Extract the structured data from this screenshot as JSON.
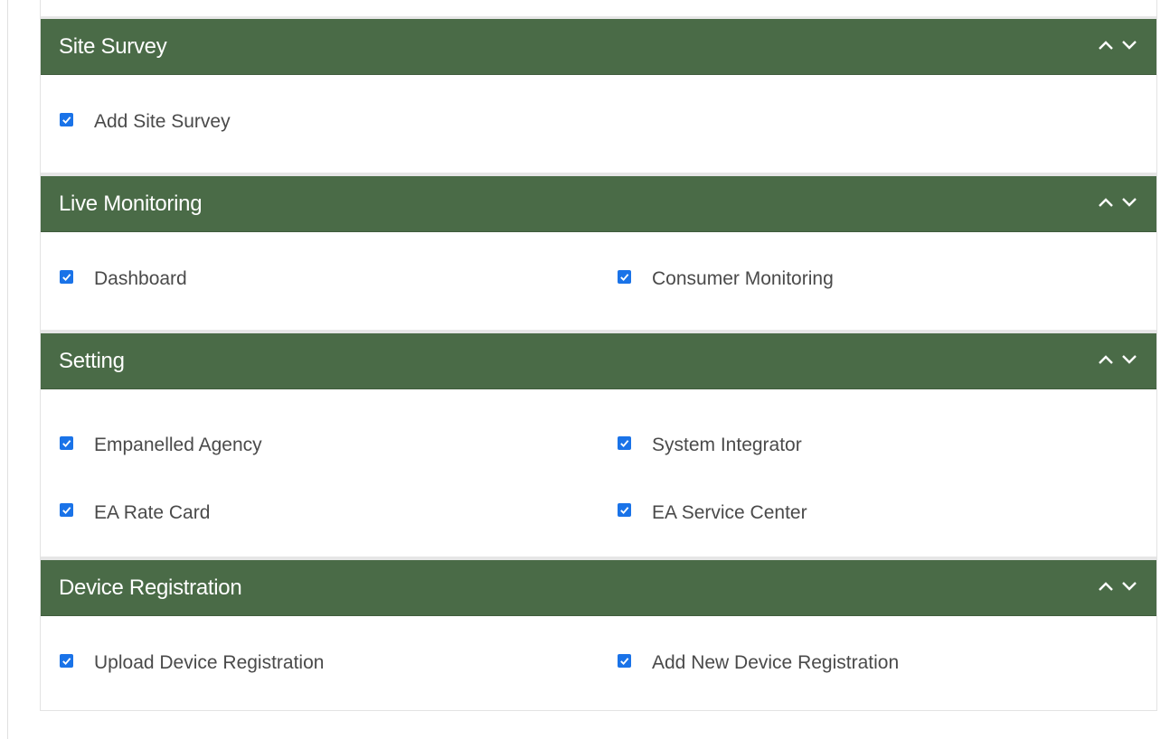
{
  "sections": [
    {
      "title": "Site Survey",
      "items": [
        {
          "label": "Add Site Survey",
          "checked": true
        }
      ]
    },
    {
      "title": "Live Monitoring",
      "items": [
        {
          "label": "Dashboard",
          "checked": true
        },
        {
          "label": "Consumer Monitoring",
          "checked": true
        }
      ]
    },
    {
      "title": "Setting",
      "items": [
        {
          "label": "Empanelled Agency",
          "checked": true
        },
        {
          "label": "System Integrator",
          "checked": true
        },
        {
          "label": "EA Rate Card",
          "checked": true
        },
        {
          "label": "EA Service Center",
          "checked": true
        }
      ]
    },
    {
      "title": "Device Registration",
      "items": [
        {
          "label": "Upload Device Registration",
          "checked": true
        },
        {
          "label": "Add New Device Registration",
          "checked": true
        }
      ]
    }
  ],
  "colors": {
    "header_bg": "#4a6b47",
    "checkbox": "#1a73e8"
  },
  "icons": {
    "expand_up": "chevron-up-icon",
    "expand_down": "chevron-down-icon",
    "checkbox": "checkmark-icon"
  }
}
